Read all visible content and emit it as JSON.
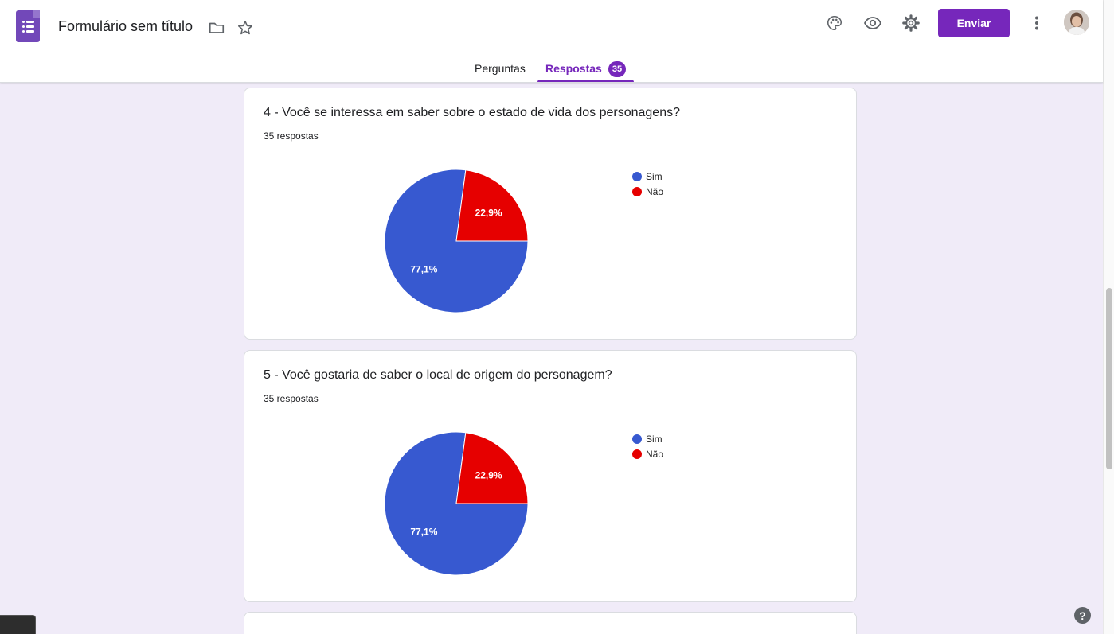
{
  "header": {
    "title": "Formulário sem título",
    "send_label": "Enviar",
    "icons": [
      "forms-logo-icon",
      "folder-icon",
      "star-icon",
      "palette-icon",
      "eye-icon",
      "gear-icon",
      "more-vert-icon"
    ]
  },
  "tabs": {
    "questions_label": "Perguntas",
    "responses_label": "Respostas",
    "responses_count": "35"
  },
  "cards": [
    {
      "title": "4 - Você se interessa em saber sobre o estado de vida dos personagens?",
      "count_label": "35 respostas",
      "chart_data": {
        "type": "pie",
        "categories": [
          "Sim",
          "Não"
        ],
        "values": [
          77.1,
          22.9
        ],
        "labels": [
          "77,1%",
          "22,9%"
        ],
        "colors": [
          "#3759d0",
          "#e60000"
        ],
        "legend": "top-right"
      }
    },
    {
      "title": "5 - Você gostaria de saber o local de origem do personagem?",
      "count_label": "35 respostas",
      "chart_data": {
        "type": "pie",
        "categories": [
          "Sim",
          "Não"
        ],
        "values": [
          77.1,
          22.9
        ],
        "labels": [
          "77,1%",
          "22,9%"
        ],
        "colors": [
          "#3759d0",
          "#e60000"
        ],
        "legend": "top-right"
      }
    }
  ],
  "help_label": "?"
}
